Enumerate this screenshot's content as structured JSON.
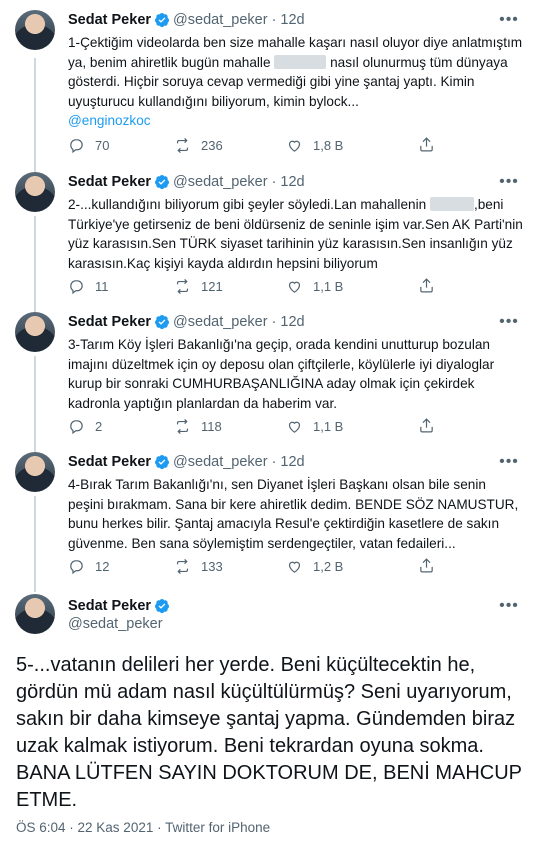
{
  "tweets": [
    {
      "name": "Sedat Peker",
      "handle": "@sedat_peker",
      "dot": "·",
      "time": "12d",
      "text_a": "1-Çektiğim videolarda ben size mahalle kaşarı nasıl oluyor diye anlatmıştım ya, benim ahiretlik bugün mahalle ",
      "text_b": " nasıl olunurmuş tüm dünyaya gösterdi. Hiçbir soruya cevap vermediği gibi yine şantaj yaptı. Kimin uyuşturucu kullandığını biliyorum, kimin bylock...",
      "mention": "@enginozkoc",
      "replies": "70",
      "retweets": "236",
      "likes": "1,8 B"
    },
    {
      "name": "Sedat Peker",
      "handle": "@sedat_peker",
      "dot": "·",
      "time": "12d",
      "text_a": "2-...kullandığını biliyorum gibi şeyler söyledi.Lan mahallenin ",
      "text_b": ",beni Türkiye'ye getirseniz de beni öldürseniz de seninle işim var.Sen AK Parti'nin yüz karasısın.Sen TÜRK siyaset tarihinin yüz karasısın.Sen insanlığın yüz karasısın.Kaç kişiyi kayda aldırdın hepsini biliyorum",
      "replies": "11",
      "retweets": "121",
      "likes": "1,1 B"
    },
    {
      "name": "Sedat Peker",
      "handle": "@sedat_peker",
      "dot": "·",
      "time": "12d",
      "text_a": "3-Tarım Köy İşleri Bakanlığı'na geçip, orada kendini unutturup bozulan imajını düzeltmek için oy deposu olan çiftçilerle, köylülerle iyi diyaloglar kurup bir sonraki CUMHURBAŞANLIĞINA aday olmak için çekirdek kadronla yaptığın planlardan da haberim var.",
      "replies": "2",
      "retweets": "118",
      "likes": "1,1 B"
    },
    {
      "name": "Sedat Peker",
      "handle": "@sedat_peker",
      "dot": "·",
      "time": "12d",
      "text_a": "4-Bırak Tarım Bakanlığı'nı, sen Diyanet İşleri Başkanı olsan bile senin peşini bırakmam. Sana bir kere ahiretlik dedim. BENDE SÖZ NAMUSTUR, bunu herkes bilir. Şantaj amacıyla Resul'e çektirdiğin kasetlere de sakın güvenme. Ben sana söylemiştim serdengeçtiler, vatan fedaileri...",
      "replies": "12",
      "retweets": "133",
      "likes": "1,2 B"
    }
  ],
  "main": {
    "name": "Sedat Peker",
    "handle": "@sedat_peker",
    "text": "5-...vatanın delileri her yerde. Beni küçültecektin he, gördün mü adam nasıl küçültülürmüş? Seni uyarıyorum, sakın bir daha kimseye şantaj yapma. Gündemden biraz uzak kalmak istiyorum. Beni tekrardan oyuna sokma. BANA LÜTFEN SAYIN DOKTORUM DE, BENİ MAHCUP ETME.",
    "footer": "ÖS 6:04 · 22 Kas 2021 · Twitter for iPhone"
  },
  "icons": {
    "more": "more-dots-icon",
    "verified": "verified-badge-icon",
    "reply": "reply-icon",
    "retweet": "retweet-icon",
    "like": "like-icon",
    "share": "share-icon"
  },
  "colors": {
    "verified": "#1d9bf0",
    "link": "#1d9bf0",
    "muted": "#536471",
    "text": "#0f1419",
    "thread_line": "#cfd9de"
  }
}
